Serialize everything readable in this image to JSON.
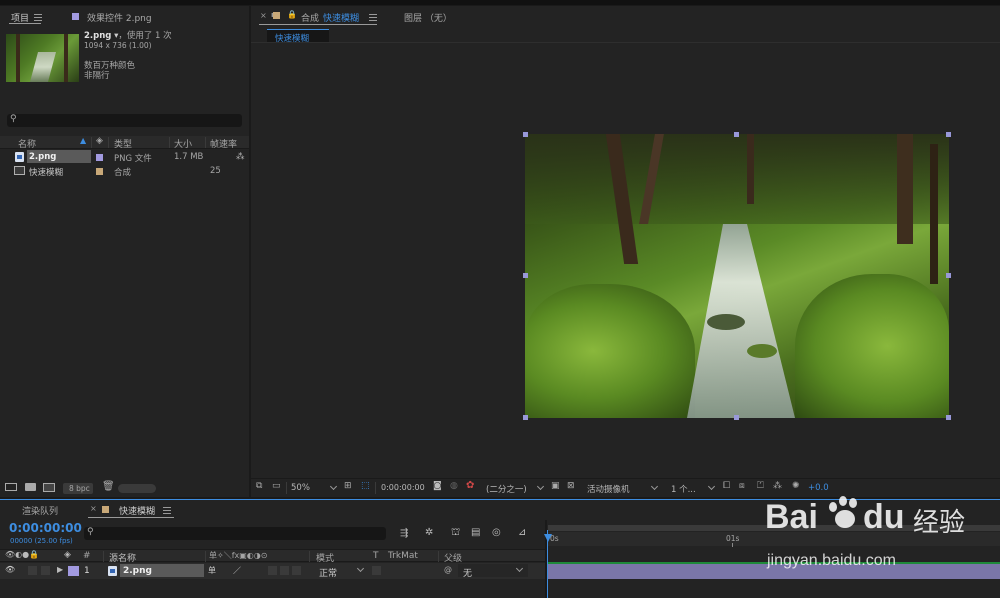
{
  "project_panel": {
    "tab_project": "项目",
    "tab_effects": "效果控件 2.png",
    "thumb_name": "2.png",
    "thumb_usage": "，使用了 1 次",
    "thumb_dims": "1094 x 736 (1.00)",
    "thumb_colors": "数百万种颜色",
    "thumb_interlace": "非隔行",
    "search_placeholder": "",
    "columns": {
      "name": "名称",
      "type": "类型",
      "size": "大小",
      "framerate": "帧速率"
    },
    "items": [
      {
        "name": "2.png",
        "type": "PNG 文件",
        "size": "1.7 MB",
        "framerate": "",
        "label_color": "#a29ae0"
      },
      {
        "name": "快速模糊",
        "type": "合成",
        "size": "",
        "framerate": "25",
        "label_color": "#c8a878"
      }
    ],
    "bpc": "8 bpc"
  },
  "comp_panel": {
    "tab_label": "合成",
    "tab_name": "快速模糊",
    "layer_tab": "图层 （无）",
    "breadcrumb": "快速模糊",
    "footer": {
      "zoom": "50%",
      "timecode": "0:00:00:00",
      "resolution": "(二分之一)",
      "camera": "活动摄像机",
      "views": "1 个...",
      "exposure": "+0.0"
    }
  },
  "timeline": {
    "tab_render": "渲染队列",
    "tab_comp": "快速模糊",
    "timecode": "0:00:00:00",
    "frame_info": "00000 (25.00 fps)",
    "columns": {
      "num": "#",
      "source": "源名称",
      "switches": "单✧＼fx▣◐◑⊙",
      "mode": "模式",
      "t": "T",
      "trkmat": "TrkMat",
      "parent": "父级"
    },
    "ruler": {
      "start": "0s",
      "mark1": "01s"
    },
    "layers": [
      {
        "num": "1",
        "name": "2.png",
        "mode": "正常",
        "parent": "无"
      }
    ]
  },
  "watermark": {
    "text_bai": "Bai",
    "text_du": "du",
    "text_jingyan": "经验",
    "url": "jingyan.baidu.com"
  }
}
